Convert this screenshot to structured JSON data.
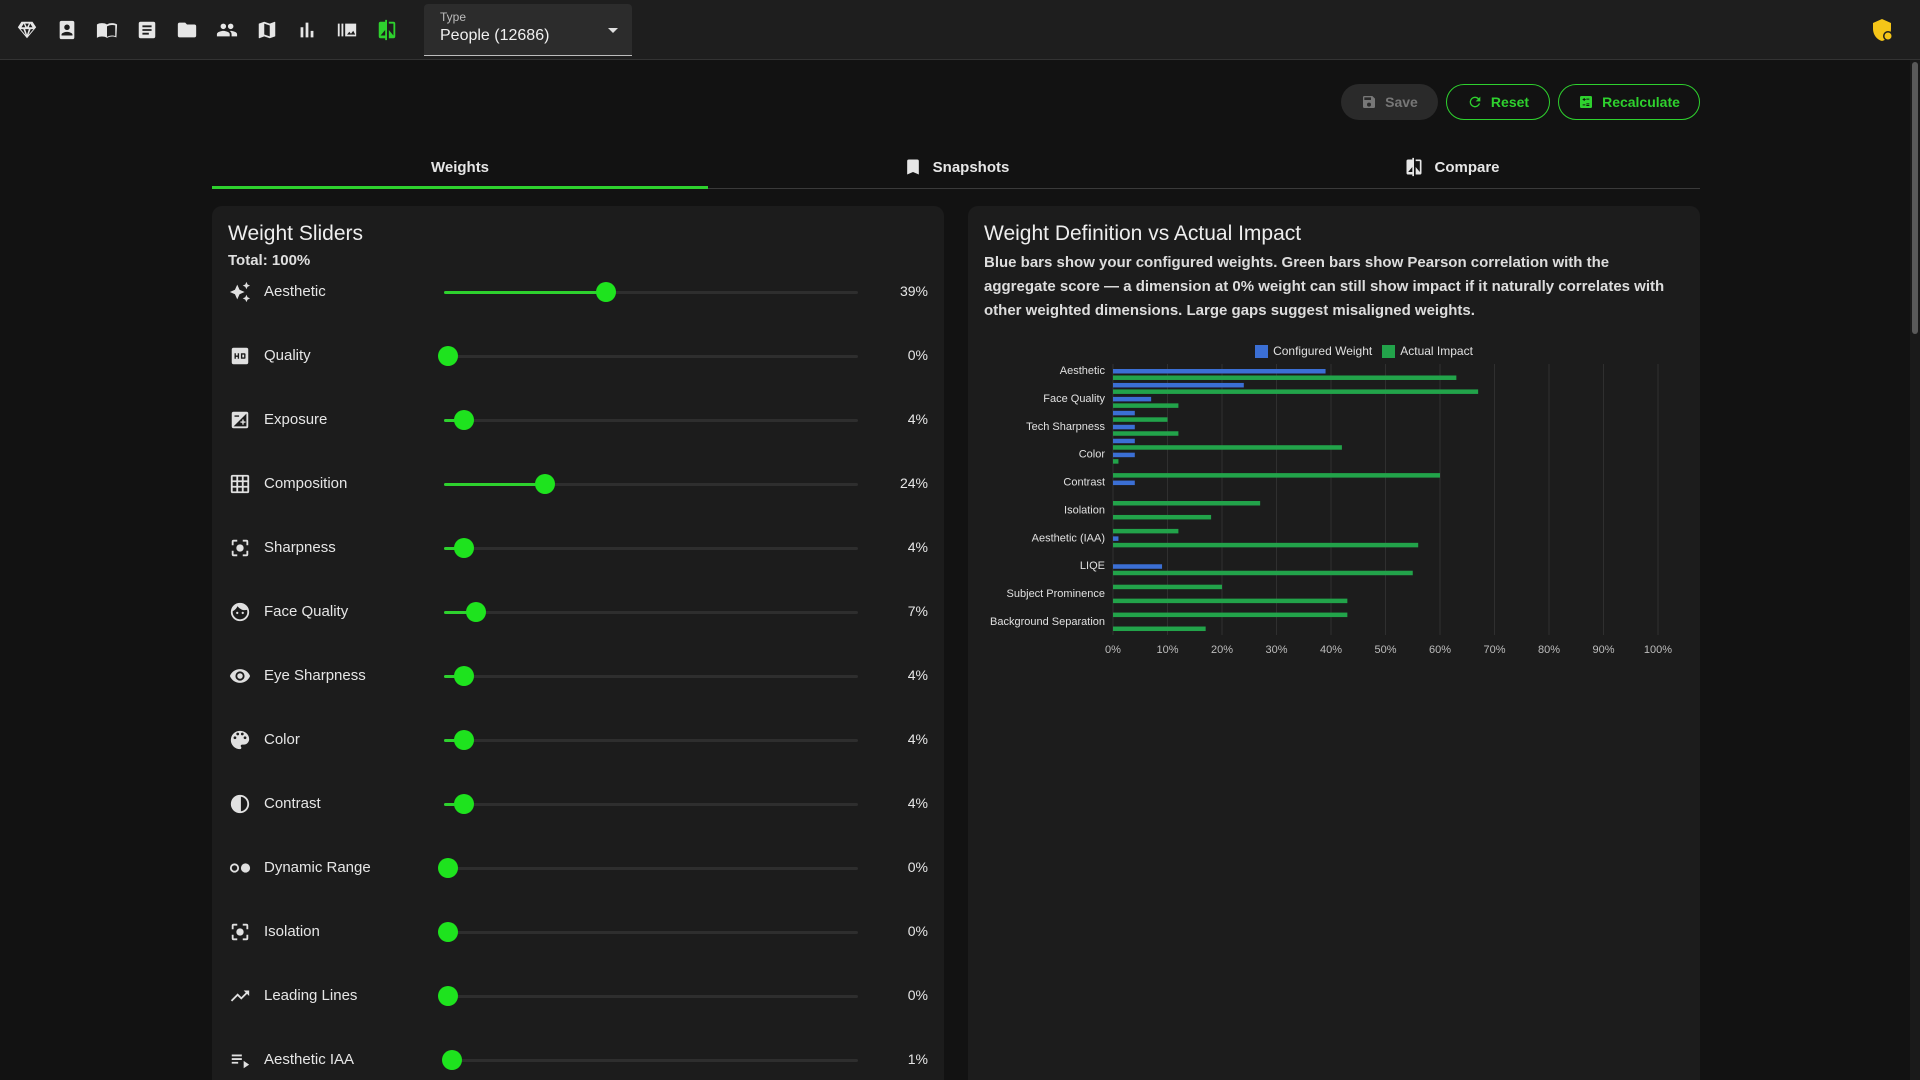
{
  "nav": {
    "icons": [
      "diamond-icon",
      "portrait-icon",
      "book-icon",
      "article-icon",
      "folder-icon",
      "people-icon",
      "map-icon",
      "bar-chart-icon",
      "gallery-icon",
      "compare-icon"
    ]
  },
  "type_select": {
    "label": "Type",
    "value": "People (12686)"
  },
  "actions": {
    "save": "Save",
    "reset": "Reset",
    "recalculate": "Recalculate"
  },
  "tabs": [
    {
      "label": "Weights"
    },
    {
      "label": "Snapshots"
    },
    {
      "label": "Compare"
    }
  ],
  "weights_panel": {
    "title": "Weight Sliders",
    "total": "Total: 100%",
    "sliders": [
      {
        "label": "Aesthetic",
        "value": "39%",
        "pct": 39,
        "icon": "sparkle-icon"
      },
      {
        "label": "Quality",
        "value": "0%",
        "pct": 0,
        "icon": "hd-icon"
      },
      {
        "label": "Exposure",
        "value": "4%",
        "pct": 4,
        "icon": "exposure-icon"
      },
      {
        "label": "Composition",
        "value": "24%",
        "pct": 24,
        "icon": "grid-icon"
      },
      {
        "label": "Sharpness",
        "value": "4%",
        "pct": 4,
        "icon": "focus-icon"
      },
      {
        "label": "Face Quality",
        "value": "7%",
        "pct": 7,
        "icon": "face-icon"
      },
      {
        "label": "Eye Sharpness",
        "value": "4%",
        "pct": 4,
        "icon": "eye-icon"
      },
      {
        "label": "Color",
        "value": "4%",
        "pct": 4,
        "icon": "palette-icon"
      },
      {
        "label": "Contrast",
        "value": "4%",
        "pct": 4,
        "icon": "contrast-icon"
      },
      {
        "label": "Dynamic Range",
        "value": "0%",
        "pct": 0,
        "icon": "toggle-icon"
      },
      {
        "label": "Isolation",
        "value": "0%",
        "pct": 0,
        "icon": "focus-icon"
      },
      {
        "label": "Leading Lines",
        "value": "0%",
        "pct": 0,
        "icon": "trend-icon"
      },
      {
        "label": "Aesthetic IAA",
        "value": "1%",
        "pct": 1,
        "icon": "list-icon"
      }
    ]
  },
  "impact_panel": {
    "title": "Weight Definition vs Actual Impact",
    "description": "Blue bars show your configured weights. Green bars show Pearson correlation with the aggregate score — a dimension at 0% weight can still show impact if it naturally correlates with other weighted dimensions. Large gaps suggest misaligned weights."
  },
  "chart_data": {
    "type": "bar",
    "orientation": "horizontal",
    "legend": [
      "Configured Weight",
      "Actual Impact"
    ],
    "legend_position": "top",
    "colors": {
      "configured": "#3b6fd4",
      "actual": "#22a34a"
    },
    "categories": [
      "Aesthetic",
      "",
      "Face Quality",
      "",
      "Tech Sharpness",
      "",
      "Color",
      "",
      "Contrast",
      "",
      "Isolation",
      "",
      "Aesthetic (IAA)",
      "",
      "LIQE",
      "",
      "Subject Prominence",
      "",
      "Background Separation"
    ],
    "series": [
      {
        "name": "Configured Weight",
        "values": [
          39,
          24,
          7,
          4,
          4,
          4,
          4,
          0,
          4,
          0,
          0,
          0,
          1,
          0,
          9,
          0,
          0,
          0,
          0
        ]
      },
      {
        "name": "Actual Impact",
        "values": [
          63,
          67,
          12,
          10,
          12,
          42,
          1,
          60,
          0,
          27,
          18,
          12,
          56,
          0,
          55,
          20,
          43,
          43,
          17
        ]
      }
    ],
    "x_ticks": [
      "0%",
      "10%",
      "20%",
      "30%",
      "40%",
      "50%",
      "60%",
      "70%",
      "80%",
      "90%",
      "100%"
    ],
    "xlim": [
      0,
      100
    ],
    "grid": true
  }
}
